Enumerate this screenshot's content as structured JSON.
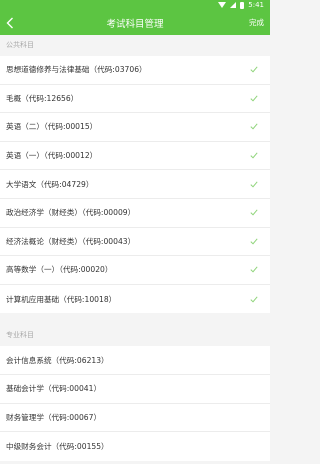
{
  "status_bar": {
    "time": "5:41"
  },
  "nav": {
    "title": "考试科目管理",
    "done_label": "完成"
  },
  "sections": [
    {
      "header": "公共科目",
      "items": [
        {
          "label": "思想道德修养与法律基础（代码:03706）",
          "checked": true
        },
        {
          "label": "毛概（代码:12656）",
          "checked": true
        },
        {
          "label": "英语（二）（代码:00015）",
          "checked": true
        },
        {
          "label": "英语（一）（代码:00012）",
          "checked": true
        },
        {
          "label": "大学语文（代码:04729）",
          "checked": true
        },
        {
          "label": "政治经济学（财经类）（代码:00009）",
          "checked": true
        },
        {
          "label": "经济法概论（财经类）（代码:00043）",
          "checked": true
        },
        {
          "label": "高等数学（一）（代码:00020）",
          "checked": true
        },
        {
          "label": "计算机应用基础（代码:10018）",
          "checked": true
        }
      ]
    },
    {
      "header": "专业科目",
      "items": [
        {
          "label": "会计信息系统（代码:06213）",
          "checked": false
        },
        {
          "label": "基础会计学（代码:00041）",
          "checked": false
        },
        {
          "label": "财务管理学（代码:00067）",
          "checked": false
        },
        {
          "label": "中级财务会计（代码:00155）",
          "checked": false
        }
      ]
    }
  ],
  "colors": {
    "accent": "#5cc542",
    "check": "#8fd47a"
  }
}
